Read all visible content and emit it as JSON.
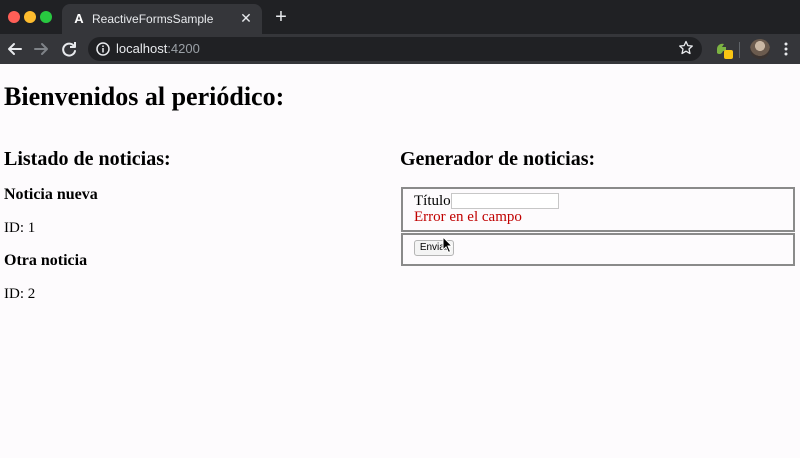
{
  "browser": {
    "tab_title": "ReactiveFormsSample",
    "tab_favicon": "A",
    "new_tab_symbol": "+",
    "close_symbol": "✕",
    "url_host": "localhost",
    "url_port": ":4200",
    "icons": [
      "back-arrow-icon",
      "forward-arrow-icon",
      "reload-icon",
      "info-icon",
      "star-icon",
      "extension-icon",
      "avatar",
      "menu-kebab-icon"
    ]
  },
  "page": {
    "title": "Bienvenidos al periódico:",
    "list": {
      "heading": "Listado de noticias:",
      "items": [
        {
          "title": "Noticia nueva",
          "id_text": "ID: 1"
        },
        {
          "title": "Otra noticia",
          "id_text": "ID: 2"
        }
      ]
    },
    "generator": {
      "heading": "Generador de noticias:",
      "field_label": "Título:",
      "field_value": "",
      "error_text": "Error en el campo",
      "error_color": "#c00000",
      "submit_label": "Enviar"
    }
  }
}
